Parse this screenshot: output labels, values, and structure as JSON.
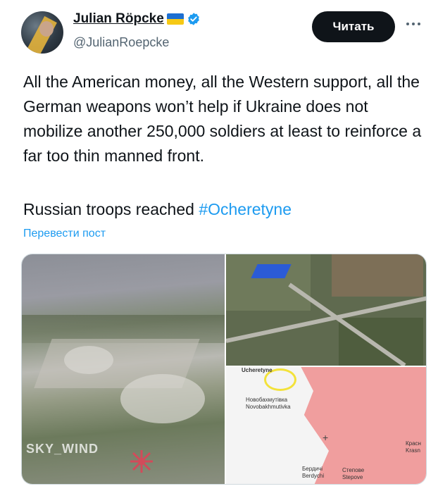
{
  "author": {
    "name": "Julian Röpcke",
    "handle": "@JulianRoepcke"
  },
  "actions": {
    "follow_label": "Читать"
  },
  "tweet": {
    "text": "All the American money, all the Western support, all the German weapons won’t help if Ukraine does not mobilize another 250,000 soldiers at least to reinforce a far too thin manned front.",
    "second_line_prefix": "Russian troops reached ",
    "hashtag": "#Ocheretyne",
    "translate_label": "Перевести пост"
  },
  "media": {
    "watermark": "SKY_WIND",
    "map_labels": {
      "top": "Ucheretyne",
      "novo_ru": "Новобахмутівка",
      "novo_en": "Novobakhmutivka",
      "berd_ru": "Бердичі",
      "berd_en": "Berdychi",
      "step_ru": "Степове",
      "step_en": "Stepove",
      "kras_ru": "Красн",
      "kras_en": "Krasn"
    }
  },
  "colors": {
    "accent": "#1d9bf0",
    "text": "#0f1419",
    "muted": "#536471",
    "button_bg": "#0f1419",
    "flag_blue": "#1d6fd1",
    "flag_yellow": "#f6c915"
  }
}
